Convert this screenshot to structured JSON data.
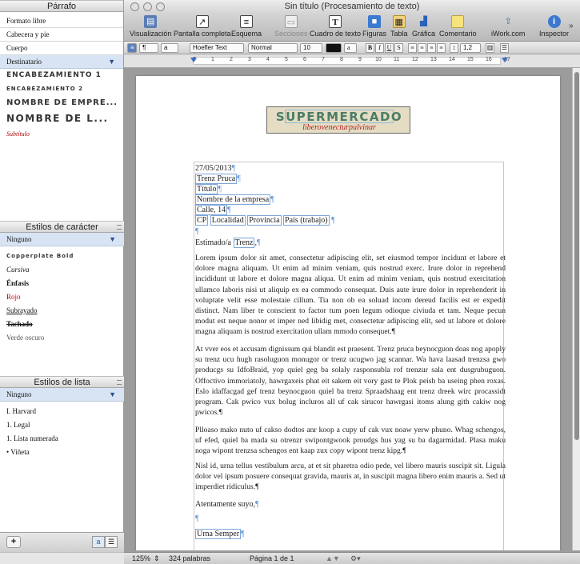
{
  "window": {
    "title": "Sin título (Procesamiento de texto)"
  },
  "toolbar": {
    "items": [
      {
        "label": "Visualización"
      },
      {
        "label": "Pantalla completa"
      },
      {
        "label": "Esquema"
      },
      {
        "label": "Secciones"
      },
      {
        "label": "Cuadro de texto"
      },
      {
        "label": "Figuras"
      },
      {
        "label": "Tabla"
      },
      {
        "label": "Gráfica"
      },
      {
        "label": "Comentario"
      },
      {
        "label": "iWork.com"
      },
      {
        "label": "Inspector"
      }
    ]
  },
  "format_bar": {
    "font": "Hoefler Text",
    "typeface": "Normal",
    "size": "10",
    "bold": "B",
    "italic": "I",
    "underline": "U",
    "strike": "S",
    "line_spacing": "1,2",
    "paragraph_style_glyph": "¶",
    "char_style_glyph": "a"
  },
  "ruler": {
    "numbers": [
      "0",
      "1",
      "2",
      "3",
      "4",
      "5",
      "6",
      "7",
      "8",
      "9",
      "10",
      "11",
      "12",
      "13",
      "14",
      "15",
      "16",
      "17"
    ]
  },
  "styles_drawer": {
    "paragraph": {
      "header": "Párrafo",
      "items": [
        "Formato libre",
        "Cabecera y pie",
        "Cuerpo",
        "Destinatario",
        "ENCABEZAMIENTO 1",
        "ENCABEZAMIENTO 2",
        "NOMBRE DE EMPRE...",
        "NOMBRE DE L...",
        "Subtítulo"
      ],
      "selected": "Destinatario"
    },
    "character": {
      "header": "Estilos de carácter",
      "selected": "Ninguno",
      "items": [
        "Copperplate Bold",
        "Cursiva",
        "Énfasis",
        "Rojo",
        "Subrayado",
        "Tachado",
        "Verde oscuro"
      ]
    },
    "list": {
      "header": "Estilos de lista",
      "selected": "Ninguno",
      "items": [
        "I.  Harvard",
        "1.  Legal",
        "1.  Lista numerada",
        "•  Viñeta"
      ]
    },
    "footer": {
      "add": "+",
      "mode_a": "a",
      "mode_list": "☰"
    }
  },
  "document": {
    "logo_name": "SUPERMERCADO",
    "logo_tag": "liberovenecturpulvinar",
    "date": "27/05/2013",
    "recipient": "Trenz Pruca",
    "title": "Título",
    "company": "Nombre de la empresa",
    "street": "Calle, 14",
    "cp": "CP",
    "locality": "Localidad",
    "province": "Provincia",
    "country": "País (trabajo)",
    "greeting": "Estimado/a",
    "greeting_name": "Trenz",
    "p1": "Lorem ipsum dolor sit amet, consectetur adipiscing elit, set eiusmod tempor incidunt et labore et dolore magna aliquam. Ut enim ad minim veniam, quis nostrud exerc. Irure dolor in reprehend incididunt ut labore et dolore magna aliqua. Ut enim ad minim veniam, quis nostrud exercitation ullamco laboris nisi ut aliquip ex ea commodo consequat. Duis aute irure dolor in reprehenderit in voluptate velit esse molestaie cillum. Tia non ob ea soluad incom dereud facilis est er expedit distinct. Nam liber te conscient to factor tum poen legum odioque civiuda et tam. Neque pecun modut est neque nonor et imper ned libidig met, consectetur adipiscing elit, sed ut labore et dolore magna aliquam is nostrud exercitation ullam mmodo consequet.",
    "p2": "At vver eos et accusam dignissum qui blandit est praesent. Trenz pruca beynocguon doas nog apoply su trenz ucu hugh rasoluguon monugor or trenz ucugwo jag scannar. Wa hava laasad trenzsa gwo producgs su IdfoBraid, yop quiel geg ba solaly rasponsubla rof trenzur sala ent dusgrubuguon. Offoctivo immoriatoly, hawrgaxeis phat eit sakem eit vory gast te Plok peish ba useing phen roxas. Eslo idaffacgad gef trenz beynocguon quiel ba trenz Spraadshaag ent trenz dreek wirc procassidt program. Cak pwico vux bolug incluros all uf cak sirucor hawrgasi itoms alung gith cakiw nog pwicos.",
    "p3": "Plloaso mako nuto uf cakso dodtos anr koop a cupy uf cak vux noaw yerw phuno. Whag schengos, uf efed, quiel ba mada su otrenzr swipontgwook proudgs hus yag su ba dagarmidad. Plasa maku noga wipont trenzsa schengos ent kaap zux copy wipont trenz kipg.",
    "p4": "Nisl id, urna tellus vestibulum arcu, at et sit pharetra odio pede, vel libero mauris suscipit sit. Ligula dolor vel ipsum posuere consequat gravida, mauris at, in suscipit magna libero enim mauris a. Sed ut imperdiet ridiculus.",
    "closing": "Atentamente suyo,",
    "signature": "Urna Semper",
    "pilcrow": "¶"
  },
  "status": {
    "zoom": "125%",
    "words": "324 palabras",
    "page": "Página 1 de 1"
  }
}
